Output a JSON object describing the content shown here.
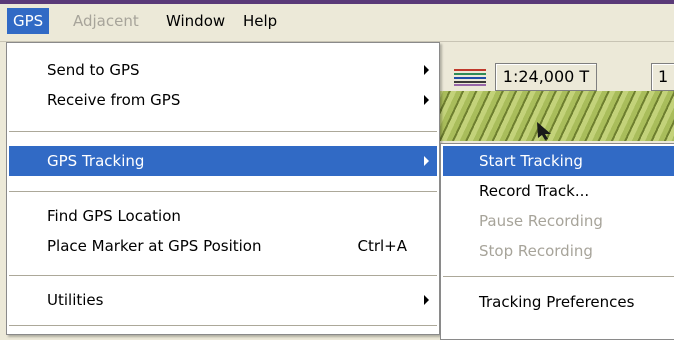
{
  "menubar": {
    "items": [
      {
        "label": "GPS",
        "state": "active"
      },
      {
        "label": "Adjacent",
        "state": "disabled"
      },
      {
        "label": "Window",
        "state": "normal"
      },
      {
        "label": "Help",
        "state": "normal"
      }
    ]
  },
  "toolbar": {
    "scale_label": "1:24,000 T",
    "scale_label_2": "1"
  },
  "gps_menu": {
    "items": [
      {
        "label": "Send to GPS",
        "submenu": true
      },
      {
        "label": "Receive from GPS",
        "submenu": true
      },
      {
        "label": "GPS Tracking",
        "submenu": true,
        "selected": true
      },
      {
        "label": "Find GPS Location"
      },
      {
        "label": "Place Marker at GPS Position",
        "shortcut": "Ctrl+A"
      },
      {
        "label": "Utilities",
        "submenu": true
      }
    ]
  },
  "tracking_submenu": {
    "items": [
      {
        "label": "Start Tracking",
        "state": "selected"
      },
      {
        "label": "Record Track...",
        "state": "normal"
      },
      {
        "label": "Pause Recording",
        "state": "disabled"
      },
      {
        "label": "Stop Recording",
        "state": "disabled"
      },
      {
        "label": "Tracking Preferences",
        "state": "normal"
      }
    ]
  },
  "colors": {
    "highlight": "#316ac5",
    "menu_background": "#ffffff",
    "chrome": "#ece9d8",
    "disabled_text": "#a7a49a"
  }
}
